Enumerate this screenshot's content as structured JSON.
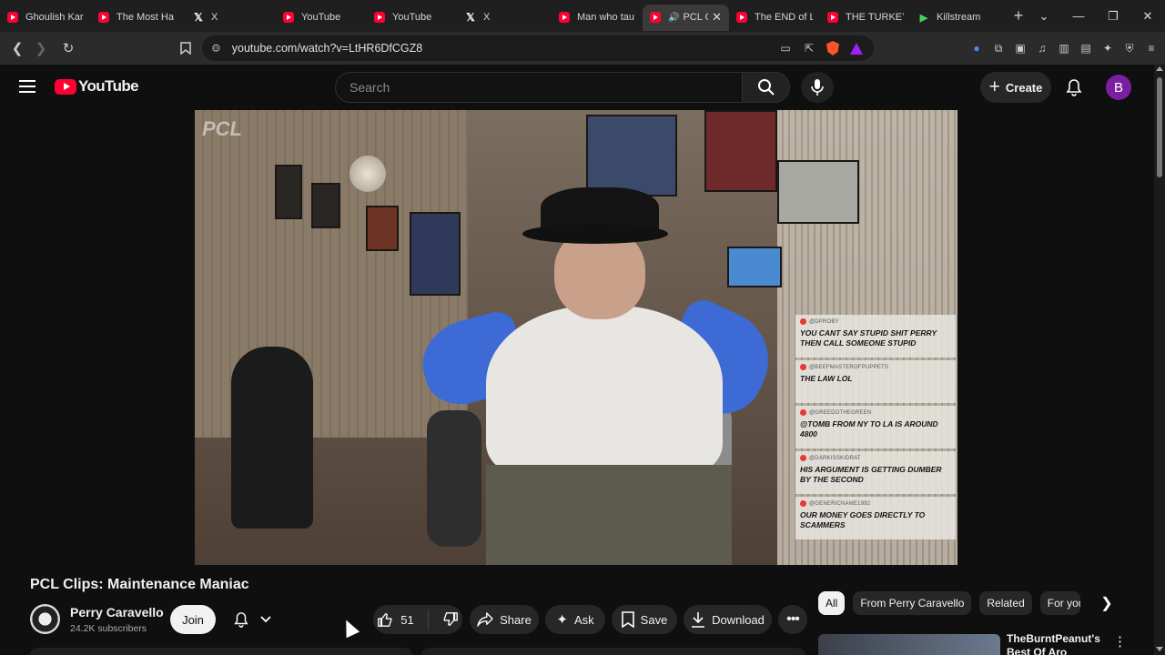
{
  "browser": {
    "tabs": [
      {
        "title": "Ghoulish Kar",
        "favicon": "youtube-icon"
      },
      {
        "title": "The Most Ha",
        "favicon": "youtube-icon"
      },
      {
        "title": "X",
        "favicon": "x-icon"
      },
      {
        "title": "YouTube",
        "favicon": "youtube-icon"
      },
      {
        "title": "YouTube",
        "favicon": "youtube-icon"
      },
      {
        "title": "X",
        "favicon": "x-icon"
      },
      {
        "title": "Man who tau",
        "favicon": "youtube-icon"
      },
      {
        "title": "PCL C",
        "favicon": "youtube-icon",
        "active": true
      },
      {
        "title": "The END of L",
        "favicon": "youtube-icon"
      },
      {
        "title": "THE TURKEY",
        "favicon": "youtube-icon"
      },
      {
        "title": "Killstream",
        "favicon": "killstream-icon"
      }
    ],
    "url": "youtube.com/watch?v=LtHR6DfCGZ8"
  },
  "youtube": {
    "logo_text": "YouTube",
    "search_placeholder": "Search",
    "create_label": "Create",
    "avatar_letter": "B"
  },
  "video": {
    "overlay_brand": "PCL",
    "chat": [
      {
        "user": "@DPROBY",
        "text": "YOU CANT SAY STUPID SHIT PERRY THEN CALL SOMEONE STUPID"
      },
      {
        "user": "@BEEFMASTEROFPUPPETS",
        "text": "THE LAW LOL"
      },
      {
        "user": "@GREEDOTHEGREEN",
        "text": "@TOMB FROM NY TO LA IS AROUND 4800"
      },
      {
        "user": "@DARKISSKIDRAT",
        "text": "HIS ARGUMENT IS GETTING DUMBER BY THE SECOND"
      },
      {
        "user": "@GENERICNAME1992",
        "text": "OUR MONEY GOES DIRECTLY TO SCAMMERS"
      }
    ]
  },
  "watch": {
    "title": "PCL Clips: Maintenance Maniac",
    "channel_name": "Perry Caravello",
    "subscribers": "24.2K subscribers",
    "join_label": "Join",
    "like_count": "51",
    "share_label": "Share",
    "ask_label": "Ask",
    "save_label": "Save",
    "download_label": "Download"
  },
  "sidebar": {
    "chips": [
      "All",
      "From Perry Caravello",
      "Related",
      "For you"
    ],
    "related": [
      {
        "title": "TheBurntPeanut's Best Of Aro"
      }
    ]
  },
  "colors": {
    "background": "#0f0f0f",
    "brand_red": "#ff0033",
    "chip_active": "#f1f1f1",
    "avatar": "#7b1fa2"
  }
}
